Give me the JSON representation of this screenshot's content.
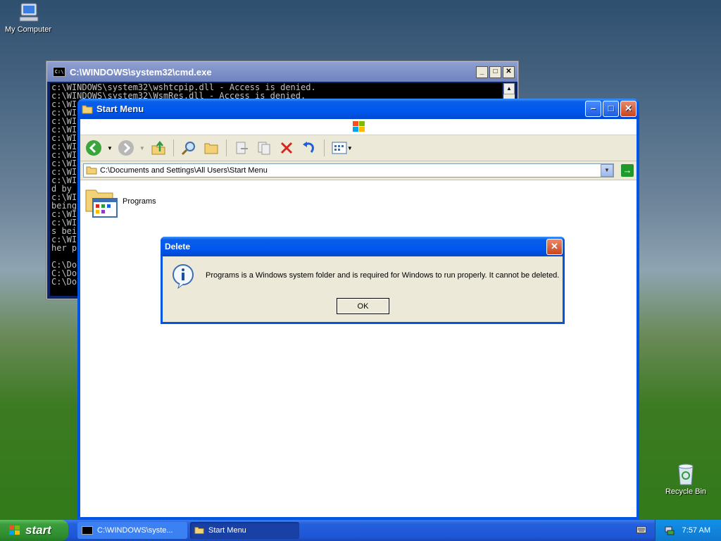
{
  "desktop": {
    "icons": [
      {
        "label": "My Computer",
        "icon": "my-computer-icon"
      },
      {
        "label": "Recycle Bin",
        "icon": "recycle-bin-icon"
      }
    ]
  },
  "cmd_window": {
    "title": "C:\\WINDOWS\\system32\\cmd.exe",
    "lines": [
      "c:\\WINDOWS\\system32\\wshtcpip.dll - Access is denied.",
      "c:\\WINDOWS\\system32\\WsmRes.dll - Access is denied.",
      "c:\\WI",
      "c:\\WI",
      "c:\\WI",
      "c:\\WI",
      "c:\\WI",
      "c:\\WI",
      "c:\\WI",
      "c:\\WI",
      "c:\\WI",
      "c:\\WI",
      "d by ",
      "c:\\WI",
      "being",
      "c:\\WI",
      "c:\\WI",
      "s bei",
      "c:\\WI",
      "her p",
      "",
      "C:\\Do",
      "C:\\Do",
      "C:\\Do"
    ]
  },
  "explorer": {
    "title": "Start Menu",
    "address": "C:\\Documents and Settings\\All Users\\Start Menu",
    "items": [
      {
        "label": "Programs",
        "icon": "programs-folder-icon"
      }
    ]
  },
  "dialog": {
    "title": "Delete",
    "message": "Programs is a Windows system folder and is required for Windows to run properly. It cannot be deleted.",
    "ok_label": "OK"
  },
  "taskbar": {
    "start_label": "start",
    "tasks": [
      {
        "label": "C:\\WINDOWS\\syste...",
        "icon": "cmd-icon"
      },
      {
        "label": "Start Menu",
        "icon": "folder-icon"
      }
    ],
    "clock": "7:57 AM"
  },
  "colors": {
    "xp_blue": "#0055e5",
    "start_green": "#3c9e3c",
    "dialog_face": "#ece9d8"
  }
}
